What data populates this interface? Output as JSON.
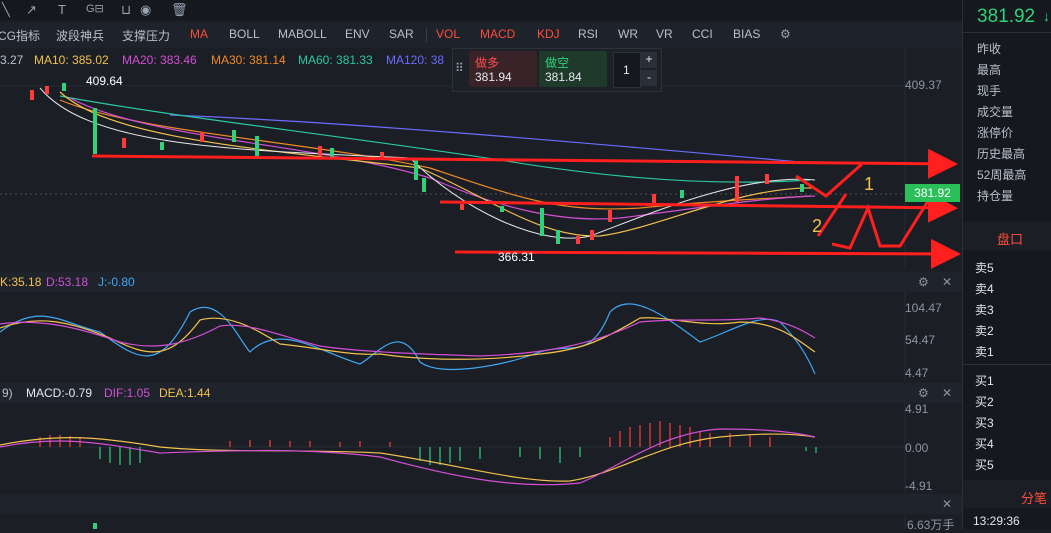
{
  "toolbar": {
    "grid_label": "G⊟"
  },
  "indicators": [
    "CG指标",
    "波段神兵",
    "支撑压力",
    "MA",
    "BOLL",
    "MABOLL",
    "ENV",
    "SAR",
    "VOL",
    "MACD",
    "KDJ",
    "RSI",
    "WR",
    "VR",
    "CCI",
    "BIAS"
  ],
  "ma_legend": {
    "first": "3.27",
    "ma10": "MA10: 385.02",
    "ma20": "MA20: 383.46",
    "ma30": "MA30: 381.14",
    "ma60": "MA60: 381.33",
    "ma120": "MA120: 38"
  },
  "trade": {
    "long_label": "做多",
    "long_value": "381.94",
    "short_label": "做空",
    "short_value": "381.84",
    "qty": "1",
    "plus": "+",
    "minus": "-"
  },
  "main_chart": {
    "high_label": "409.64",
    "low_label": "366.31",
    "axis_top": "409.37",
    "price_tag": "381.92",
    "marks": [
      "1",
      "2"
    ]
  },
  "kdj": {
    "k": "K:35.18",
    "d": "D:53.18",
    "j": "J:-0.80",
    "axis": [
      "104.47",
      "54.47",
      "4.47"
    ]
  },
  "macd": {
    "title": "9)",
    "macd": "MACD:-0.79",
    "dif": "DIF:1.05",
    "dea": "DEA:1.44",
    "axis": [
      "4.91",
      "0.00",
      "-4.91"
    ]
  },
  "vol": {
    "axis": "6.63万手"
  },
  "panel": {
    "price": "381.92",
    "labels": [
      "昨收",
      "最高",
      "现手",
      "成交量",
      "涨停价",
      "历史最高",
      "52周最高",
      "持仓量"
    ],
    "book_title": "盘口",
    "sells": [
      "卖5",
      "卖4",
      "卖3",
      "卖2",
      "卖1"
    ],
    "buys": [
      "买1",
      "买2",
      "买3",
      "买4",
      "买5"
    ],
    "trades_title": "分笔",
    "time": "13:29:36"
  },
  "colors": {
    "up": "#ff3b3b",
    "down": "#2fd17a",
    "arrow": "#ff1f1f",
    "ma10": "#f2c14e",
    "ma20": "#d34fd6",
    "ma30": "#f08a24",
    "ma60": "#2bc7a2",
    "ma120": "#6c6cff"
  }
}
